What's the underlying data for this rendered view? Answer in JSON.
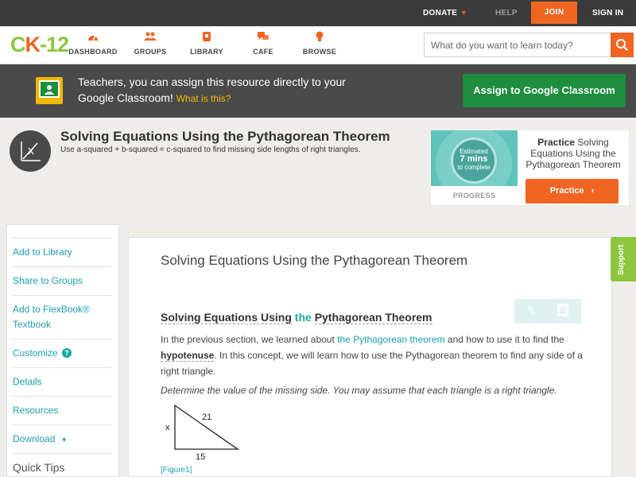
{
  "topbar": {
    "donate": "DONATE",
    "help": "HELP",
    "join": "JOIN",
    "sign_in": "SIGN IN"
  },
  "logo": {
    "text_a": "C",
    "text_b": "K",
    "text_c": "-12"
  },
  "nav": [
    {
      "label": "DASHBOARD",
      "icon": "dashboard-icon"
    },
    {
      "label": "GROUPS",
      "icon": "groups-icon"
    },
    {
      "label": "LIBRARY",
      "icon": "library-icon"
    },
    {
      "label": "CAFE",
      "icon": "cafe-icon"
    },
    {
      "label": "BROWSE",
      "icon": "browse-icon"
    }
  ],
  "search": {
    "placeholder": "What do you want to learn today?"
  },
  "classroom": {
    "message": "Teachers, you can assign this resource directly to your Google Classroom!",
    "what_link": "What is this?",
    "assign_button": "Assign to Google Classroom"
  },
  "concept": {
    "title": "Solving Equations Using the Pythagorean Theorem",
    "subtitle": "Use a-squared + b-squared = c-squared to find missing side lengths of right triangles."
  },
  "practice": {
    "est_top": "Estimated",
    "est_mid": "7 mins",
    "est_bottom": "to complete",
    "progress_label": "PROGRESS",
    "heading_bold": "Practice",
    "heading_rest": "Solving Equations Using the Pythagorean Theorem",
    "button": "Practice"
  },
  "sidebar": {
    "items": [
      "Add to Library",
      "Share to Groups",
      "Add to FlexBook® Textbook",
      "Customize",
      "Details",
      "Resources",
      "Download"
    ],
    "quick_tips": "Quick Tips"
  },
  "main": {
    "page_title": "Solving Equations Using the Pythagorean Theorem",
    "section_title_a": "Solving Equations Using",
    "section_title_b": "the",
    "section_title_c": "Pythagorean Theorem",
    "para_a": "In the previous section, we learned about",
    "para_link": "the Pythagorean theorem",
    "para_b": "and how to use it to find the",
    "para_hyp": "hypotenuse",
    "para_c": ". In this concept, we will learn how to use the Pythagorean theorem to find any side of a right triangle.",
    "instruction": "Determine the value of the missing side. You may assume that each triangle is a right triangle.",
    "triangle": {
      "side_x": "x",
      "side_hyp": "21",
      "side_base": "15"
    },
    "figure_link": "[Figure1]"
  },
  "support_tab": "Support",
  "colors": {
    "accent": "#f16522",
    "brand_green": "#8cc63f",
    "link": "#1a9fb0",
    "classroom_green": "#1e8e3e"
  }
}
